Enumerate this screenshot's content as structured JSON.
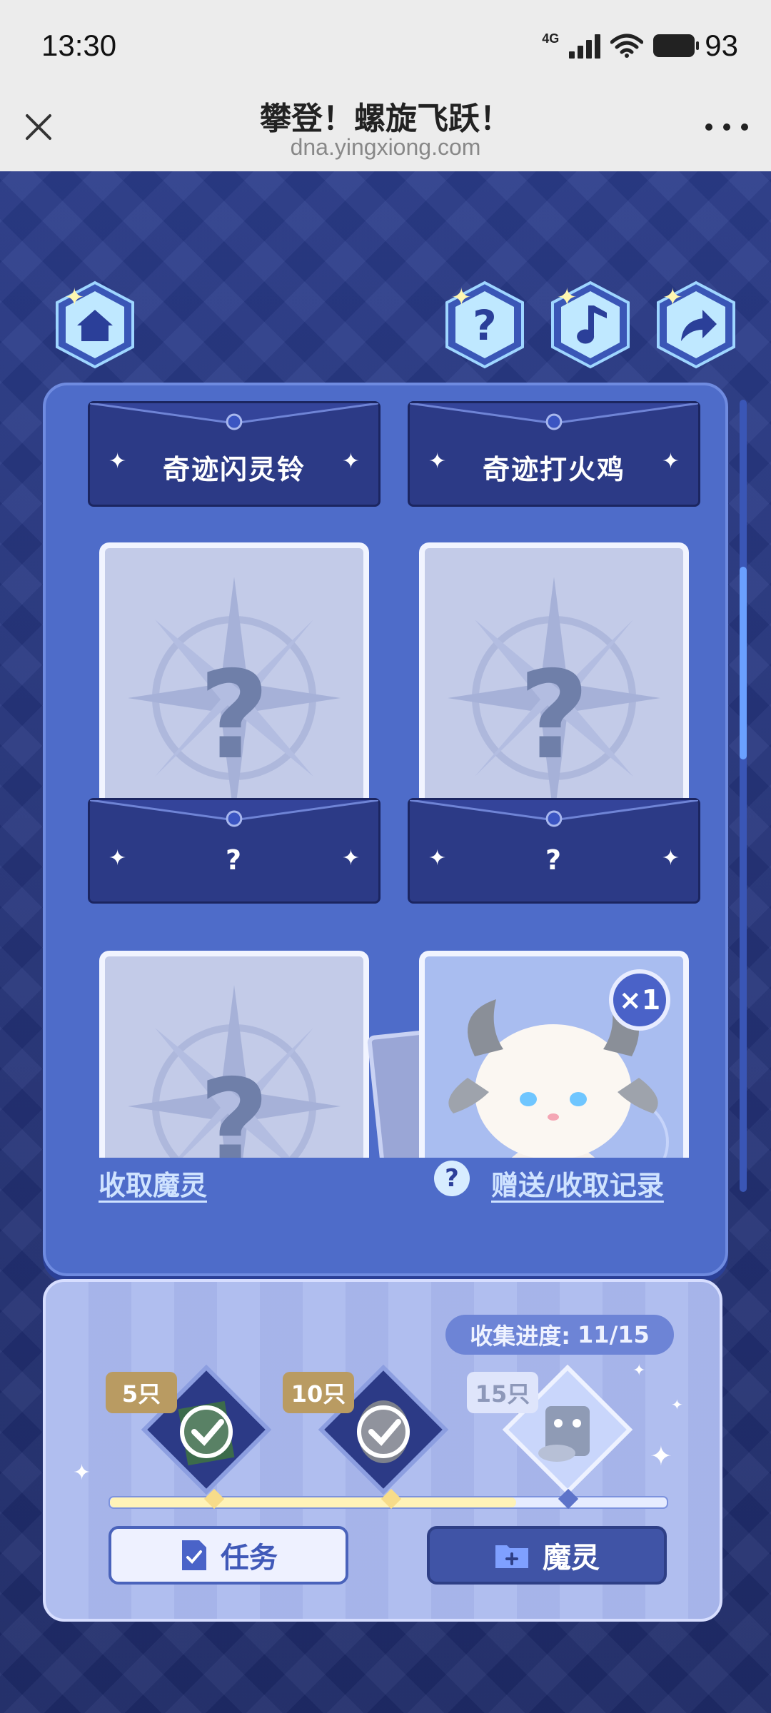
{
  "status_bar": {
    "time": "13:30",
    "network": "4G",
    "battery": "93"
  },
  "browser": {
    "title": "攀登！螺旋飞跃！",
    "url": "dna.yingxiong.com",
    "close_icon": "close-icon",
    "more_icon": "more-icon"
  },
  "top_buttons": [
    {
      "name": "home",
      "icon": "home-icon"
    },
    {
      "name": "help",
      "icon": "question-icon"
    },
    {
      "name": "music",
      "icon": "music-note-icon"
    },
    {
      "name": "share",
      "icon": "share-arrow-icon"
    }
  ],
  "cards": [
    {
      "name": "奇迹闪灵铃",
      "state": "collected"
    },
    {
      "name": "奇迹打火鸡",
      "state": "collected"
    },
    {
      "name": "?",
      "state": "locked"
    },
    {
      "name": "?",
      "state": "locked"
    },
    {
      "name": "",
      "state": "locked"
    },
    {
      "name": "",
      "state": "collected",
      "count": "×1"
    }
  ],
  "panel_links": {
    "receive": "收取魔灵",
    "records": "赠送/收取记录",
    "help": "?"
  },
  "progress": {
    "label": "收集进度:",
    "value": "11/15",
    "current": 11,
    "total": 15,
    "milestones": [
      {
        "label": "5只",
        "done": true
      },
      {
        "label": "10只",
        "done": true
      },
      {
        "label": "15只",
        "done": false
      }
    ]
  },
  "buttons": {
    "tasks": "任务",
    "spirits": "魔灵"
  },
  "colors": {
    "accent": "#4e6cc9",
    "dark": "#2c3a86",
    "light": "#a9b8ee"
  }
}
